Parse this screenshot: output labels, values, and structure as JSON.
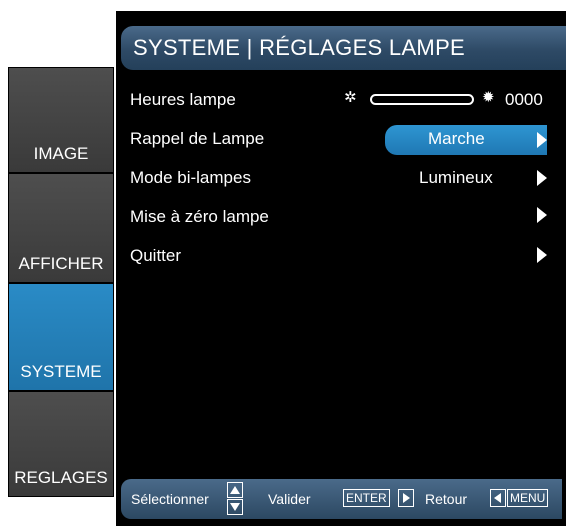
{
  "header": {
    "title": "SYSTEME | RÉGLAGES LAMPE"
  },
  "sidebar": {
    "tabs": [
      {
        "label": "IMAGE",
        "selected": false
      },
      {
        "label": "AFFICHER",
        "selected": false
      },
      {
        "label": "SYSTEME",
        "selected": true
      },
      {
        "label": "REGLAGES",
        "selected": false
      }
    ]
  },
  "menu": {
    "items": [
      {
        "label": "Heures lampe",
        "value": "0000",
        "lamp_usage_fraction": 0.0
      },
      {
        "label": "Rappel de Lampe",
        "value": "Marche",
        "highlighted": true
      },
      {
        "label": "Mode bi-lampes",
        "value": "Lumineux"
      },
      {
        "label": "Mise à zéro lampe",
        "value": ""
      },
      {
        "label": "Quitter",
        "value": ""
      }
    ]
  },
  "footer": {
    "select_label": "Sélectionner",
    "validate_label": "Valider",
    "enter_key": "ENTER",
    "back_label": "Retour",
    "menu_key": "MENU"
  },
  "colors": {
    "background": "#000000",
    "accent": "#1f78b4",
    "tab_inactive": "#444444",
    "text": "#ffffff"
  },
  "icons": [
    "lamp-dim-icon",
    "lamp-bright-icon",
    "arrow-right-icon",
    "arrow-up-icon",
    "arrow-down-icon",
    "arrow-left-icon"
  ]
}
